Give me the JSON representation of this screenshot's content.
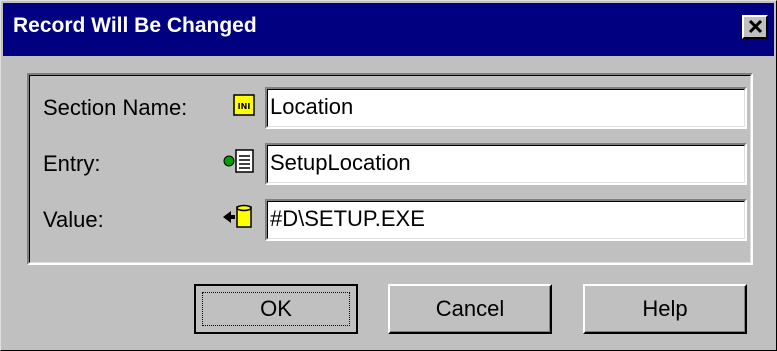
{
  "dialog": {
    "title": "Record Will Be Changed",
    "close_icon": "close-icon"
  },
  "fields": {
    "section_name": {
      "label": "Section Name:",
      "value": "Location",
      "icon": "ini-file-icon"
    },
    "entry": {
      "label": "Entry:",
      "value": "SetupLocation",
      "icon": "entry-document-icon"
    },
    "value": {
      "label": "Value:",
      "value": "#D\\SETUP.EXE",
      "icon": "value-cylinder-icon"
    }
  },
  "buttons": {
    "ok": "OK",
    "cancel": "Cancel",
    "help": "Help"
  },
  "colors": {
    "titlebar": "#000080",
    "face": "#c0c0c0"
  }
}
